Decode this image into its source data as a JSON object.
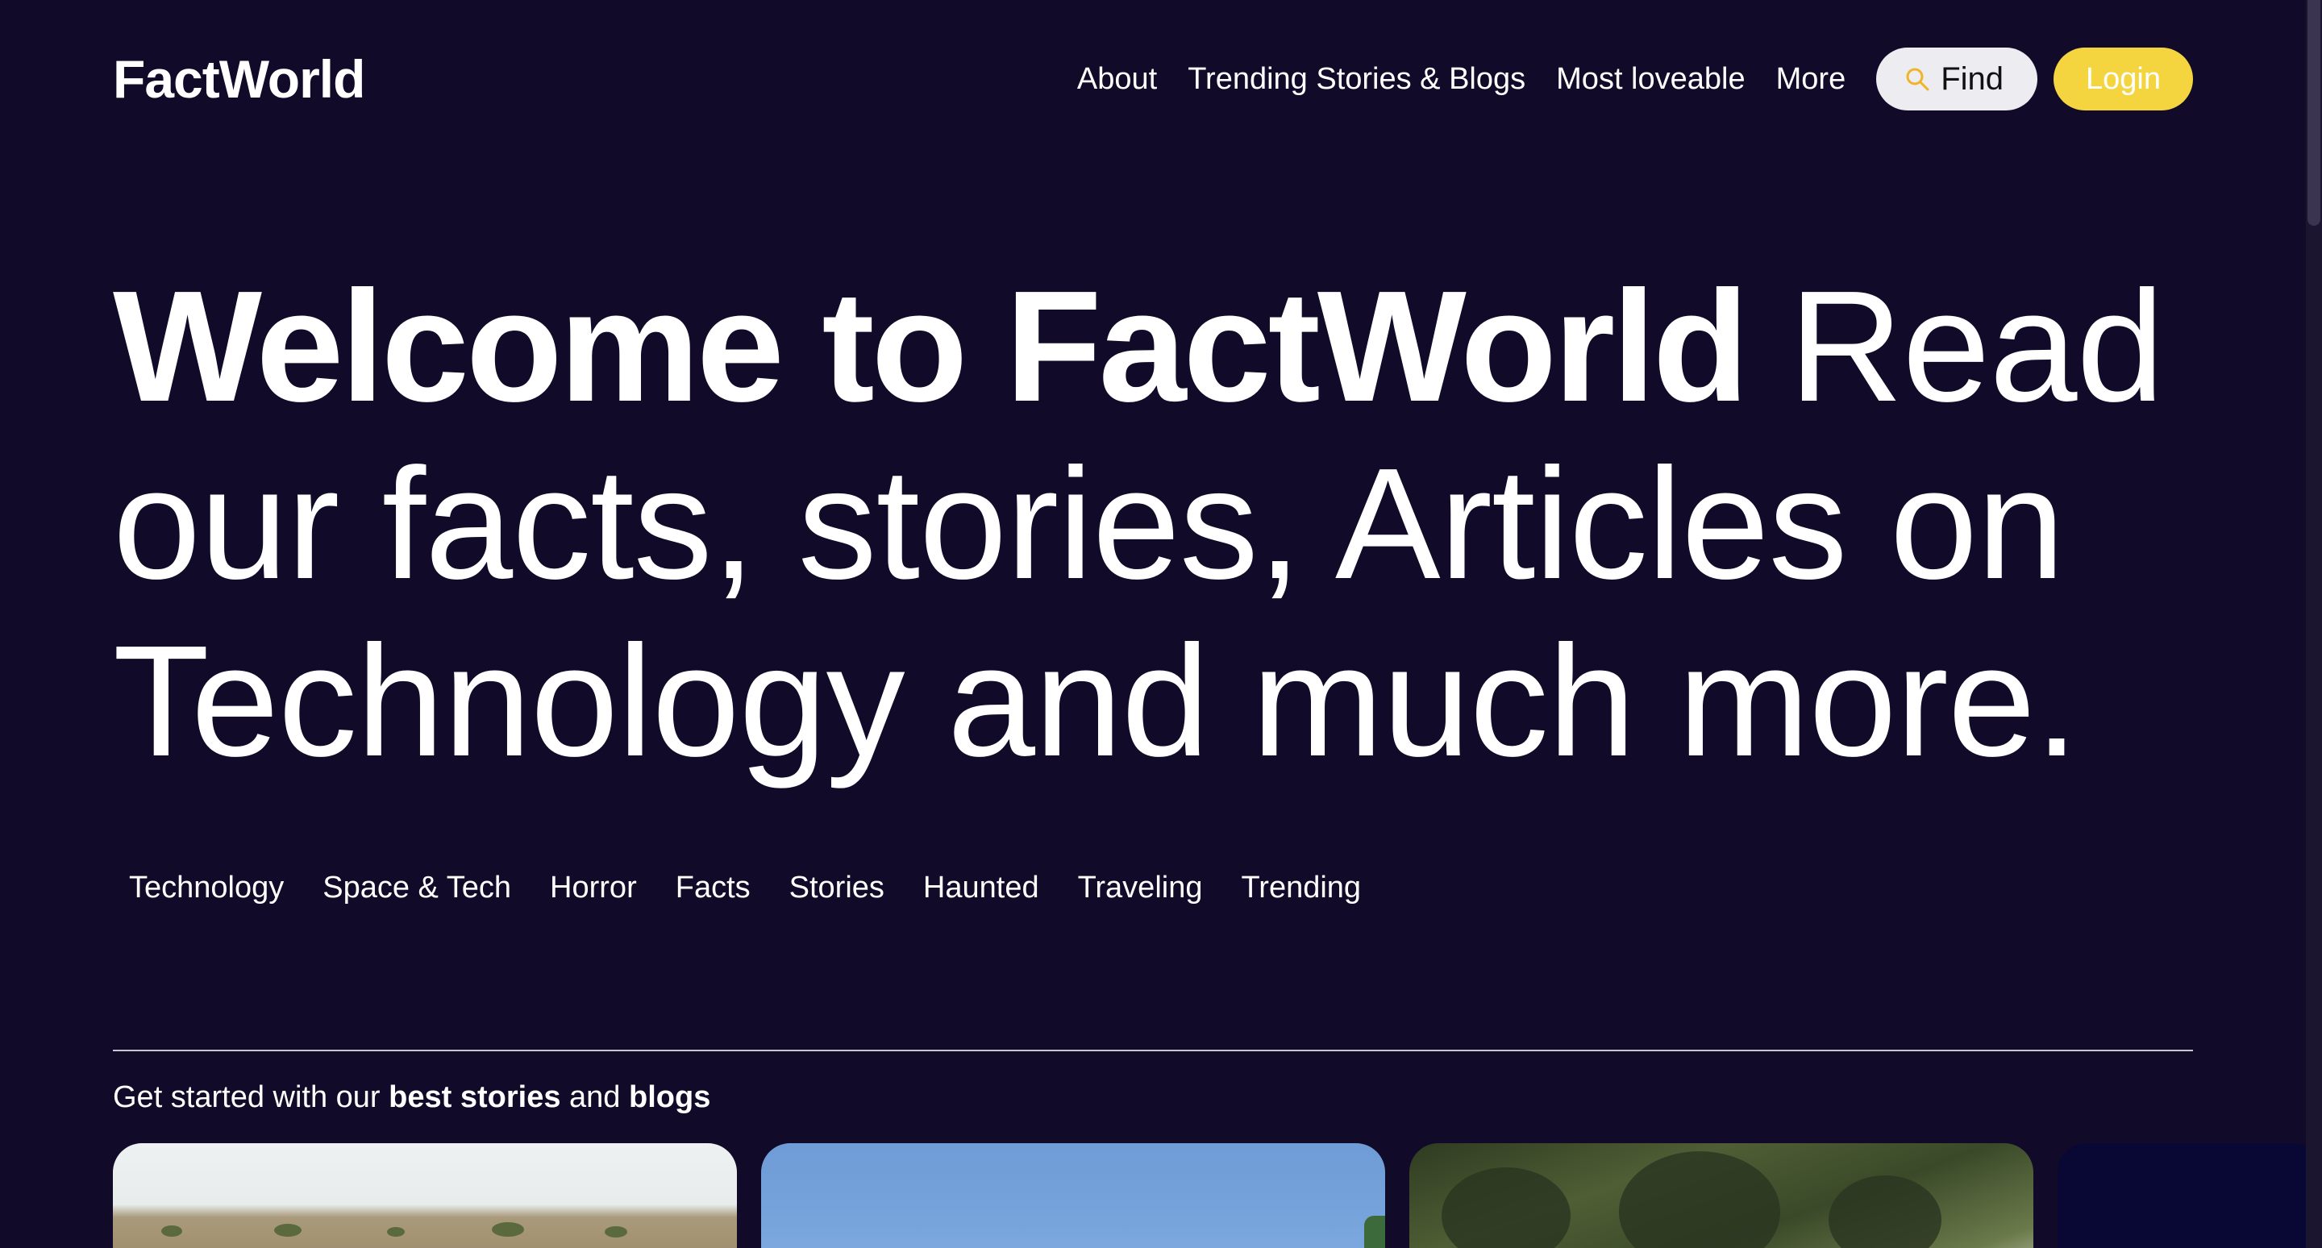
{
  "header": {
    "logo": "FactWorld",
    "nav": [
      "About",
      "Trending Stories & Blogs",
      "Most loveable",
      "More"
    ],
    "find_label": "Find",
    "login_label": "Login"
  },
  "hero": {
    "bold": "Welcome to FactWorld",
    "rest": " Read our facts, stories, Articles on Technology and much more."
  },
  "categories": [
    "Technology",
    "Space & Tech",
    "Horror",
    "Facts",
    "Stories",
    "Haunted",
    "Traveling",
    "Trending"
  ],
  "section": {
    "prefix": "Get started with our ",
    "bold_1": "best stories",
    "middle": " and ",
    "bold_2": "blogs"
  },
  "colors": {
    "background": "#110b29",
    "login_button": "#f5d53f",
    "find_button": "#ececf1",
    "find_icon": "#f0b429"
  },
  "icons": {
    "find": "search-icon"
  }
}
